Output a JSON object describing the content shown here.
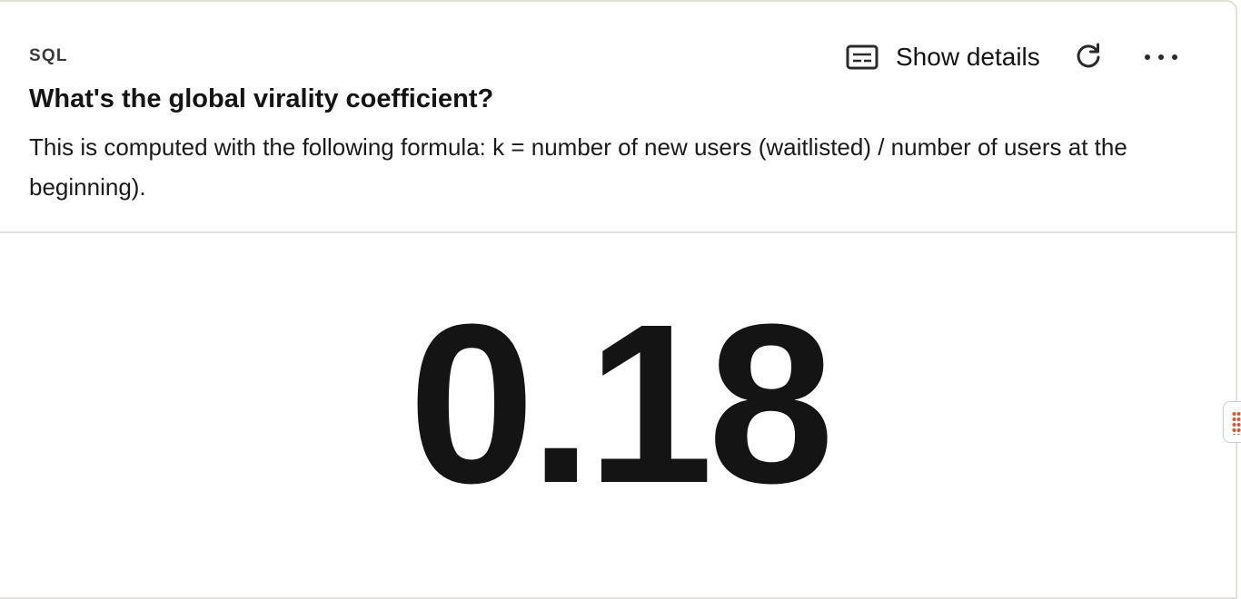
{
  "card": {
    "tag": "SQL",
    "title": "What's the global virality coefficient?",
    "description": "This is computed with the following formula: k = number of new users (waitlisted) / number of users at the beginning).",
    "actions": {
      "details_label": "Show details",
      "details_icon": "subtitles-icon",
      "refresh_icon": "refresh-icon",
      "more_icon": "more-horizontal-icon"
    },
    "metric_value": "0.18"
  },
  "side_handle": {
    "icon": "drag-handle-icon",
    "color": "#e4542a"
  },
  "colors": {
    "text": "#141414",
    "border": "#e2e1da",
    "accent": "#e4542a"
  }
}
